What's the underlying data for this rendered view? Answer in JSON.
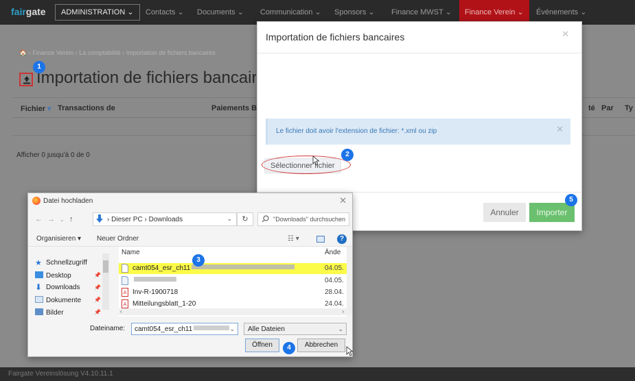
{
  "nav": {
    "logo_a": "fair",
    "logo_b": "gate",
    "admin_label": "ADMINISTRATION",
    "items": [
      "Contacts",
      "Documents",
      "Communication",
      "Sponsors",
      "Finance MWST",
      "Finance Verein",
      "Événements"
    ]
  },
  "page": {
    "breadcrumb": "Finance Verein › La comptabilité › Importation de fichiers bancaires",
    "title": "Importation de fichiers bancaires",
    "columns": [
      "Fichier",
      "Transactions de",
      "Paiements B",
      "té",
      "Par",
      "Ty"
    ],
    "show_count": "Afficher 0 jusqu'à 0 de 0",
    "footer": "Fairgate Vereinslösung V4.10.11.1"
  },
  "modal": {
    "title": "Importation de fichiers bancaires",
    "alert": "Le fichier doit avoir l'extension de fichier: *.xml ou zip",
    "select_file": "Sélectionner fichier",
    "cancel": "Annuler",
    "import": "Importer"
  },
  "dialog": {
    "title": "Datei hochladen",
    "path_pc": "Dieser PC",
    "path_folder": "Downloads",
    "search_placeholder": "\"Downloads\" durchsuchen",
    "organize": "Organisieren",
    "new_folder": "Neuer Ordner",
    "col_name": "Name",
    "col_date": "Ände",
    "sidebar": [
      "Schnellzugriff",
      "Desktop",
      "Downloads",
      "Dokumente",
      "Bilder"
    ],
    "files": [
      {
        "name": "camt054_esr_ch11",
        "date": "04.05."
      },
      {
        "name": "",
        "date": "04.05."
      },
      {
        "name": "Inv-R-1900718",
        "date": "28.04."
      },
      {
        "name": "Mitteilungsblatt_1-20",
        "date": "24.04."
      }
    ],
    "filename_label": "Dateiname:",
    "filename_value": "camt054_esr_ch11",
    "filetype": "Alle Dateien",
    "open": "Öffnen",
    "cancel": "Abbrechen"
  },
  "markers": [
    "1",
    "2",
    "3",
    "4",
    "5"
  ],
  "colors": {
    "accent_red": "#b11218",
    "marker_blue": "#1c74e8",
    "import_green": "#6ac06e",
    "highlight_yellow": "#fbfb49"
  }
}
